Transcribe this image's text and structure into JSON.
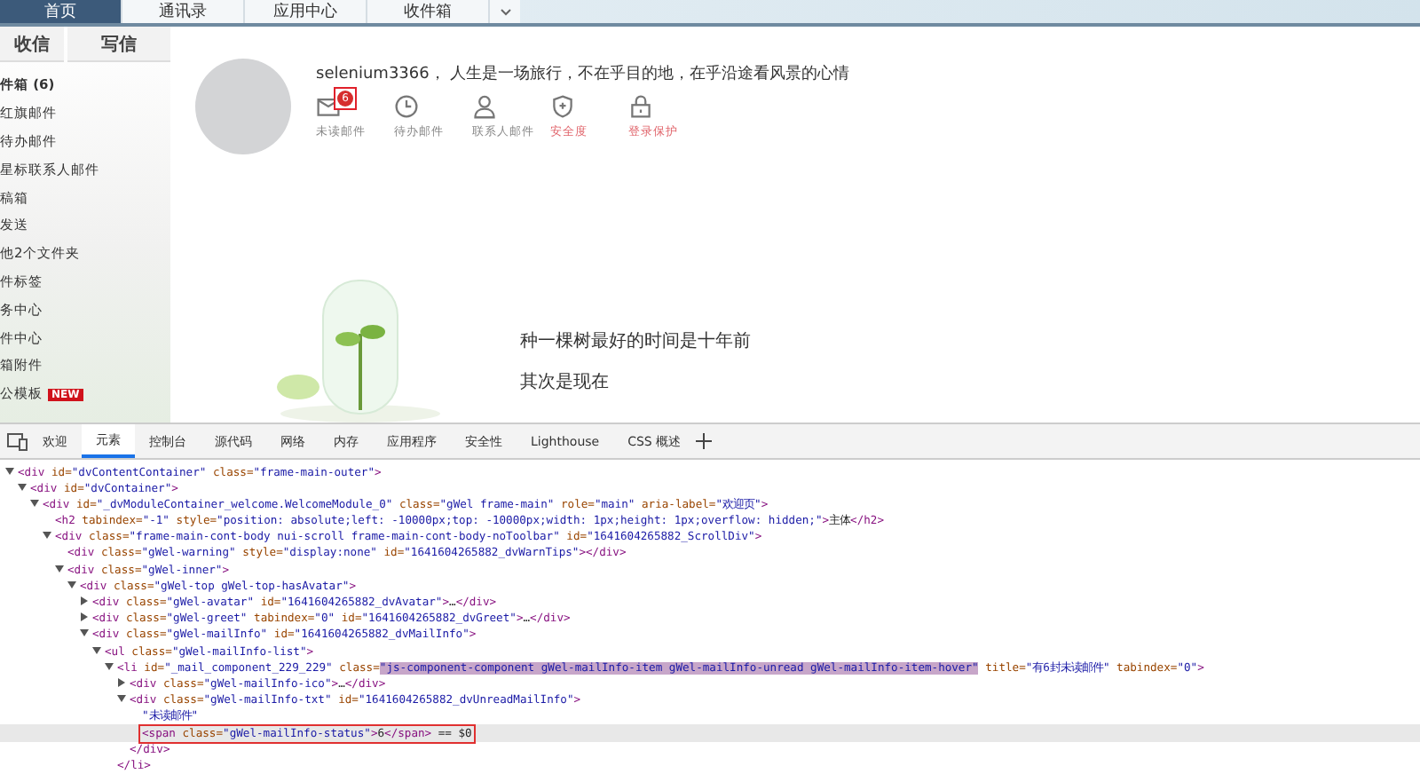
{
  "nav_tabs": [
    {
      "label": "首页",
      "selected": true
    },
    {
      "label": "通讯录",
      "selected": false
    },
    {
      "label": "应用中心",
      "selected": false
    },
    {
      "label": "收件箱",
      "selected": false
    }
  ],
  "sidebar": {
    "buttons": [
      "收信",
      "写信"
    ],
    "items": [
      {
        "label": "件箱 (6)",
        "bold": true
      },
      {
        "label": "红旗邮件",
        "bold": false
      },
      {
        "label": "待办邮件",
        "bold": false
      },
      {
        "label": "星标联系人邮件",
        "bold": false
      },
      {
        "label": "稿箱",
        "bold": false
      },
      {
        "label": "发送",
        "bold": false
      },
      {
        "label": "他2个文件夹",
        "bold": false
      },
      {
        "label": "件标签",
        "bold": false
      },
      {
        "label": "务中心",
        "bold": false
      },
      {
        "label": "件中心",
        "bold": false
      },
      {
        "label": "箱附件",
        "bold": false
      },
      {
        "label": "公模板",
        "bold": false,
        "badge": "NEW"
      }
    ]
  },
  "greeting": "selenium3366， 人生是一场旅行，不在乎目的地，在乎沿途看风景的心情",
  "mail_info": [
    {
      "kind": "mail",
      "label": "未读邮件",
      "badge": "6",
      "alert": false
    },
    {
      "kind": "clock",
      "label": "待办邮件",
      "alert": false
    },
    {
      "kind": "contact",
      "label": "联系人邮件",
      "alert": false
    },
    {
      "kind": "shield",
      "label": "安全度",
      "alert": true
    },
    {
      "kind": "lock",
      "label": "登录保护",
      "alert": true
    }
  ],
  "quote": [
    "种一棵树最好的时间是十年前",
    "其次是现在"
  ],
  "devtools": {
    "tabs": [
      {
        "label": "欢迎",
        "selected": false
      },
      {
        "label": "元素",
        "selected": true
      },
      {
        "label": "控制台",
        "selected": false
      },
      {
        "label": "源代码",
        "selected": false
      },
      {
        "label": "网络",
        "selected": false
      },
      {
        "label": "内存",
        "selected": false
      },
      {
        "label": "应用程序",
        "selected": false
      },
      {
        "label": "安全性",
        "selected": false
      },
      {
        "label": "Lighthouse",
        "selected": false
      },
      {
        "label": "CSS 概述",
        "selected": false
      }
    ],
    "tree": [
      {
        "text": "<div id=\"dvContentContainer\" class=\"frame-main-outer\">",
        "expanded": true,
        "children": [
          {
            "text": "<div id=\"dvContainer\">",
            "expanded": true,
            "children": [
              {
                "text": "<div id=\"_dvModuleContainer_welcome.WelcomeModule_0\" class=\"gWel frame-main\" role=\"main\" aria-label=\"欢迎页\">",
                "expanded": true,
                "children": [
                  {
                    "text": "<h2 tabindex=\"-1\" style=\"position: absolute;left: -10000px;top: -10000px;width: 1px;height: 1px;overflow: hidden;\">主体</h2>"
                  },
                  {
                    "text": "<div class=\"frame-main-cont-body nui-scroll frame-main-cont-body-noToolbar\" id=\"1641604265882_ScrollDiv\">",
                    "expanded": true,
                    "children": [
                      {
                        "text": "<div class=\"gWel-warning\" style=\"display:none\" id=\"1641604265882_dvWarnTips\"></div>"
                      },
                      {
                        "text": "<div class=\"gWel-inner\">",
                        "expanded": true,
                        "children": [
                          {
                            "text": "<div class=\"gWel-top gWel-top-hasAvatar\">",
                            "expanded": true,
                            "children": [
                              {
                                "text": "<div class=\"gWel-avatar\" id=\"1641604265882_dvAvatar\">…</div>",
                                "expanded": false
                              },
                              {
                                "text": "<div class=\"gWel-greet\" tabindex=\"0\" id=\"1641604265882_dvGreet\">…</div>",
                                "expanded": false
                              },
                              {
                                "text": "<div class=\"gWel-mailInfo\" id=\"1641604265882_dvMailInfo\">",
                                "expanded": true,
                                "children": [
                                  {
                                    "text": "<ul class=\"gWel-mailInfo-list\">",
                                    "expanded": true,
                                    "children": [
                                      {
                                        "text": "<li id=\"_mail_component_229_229\" class=\"js-component-component gWel-mailInfo-item gWel-mailInfo-unread gWel-mailInfo-item-hover\" title=\"有6封未读邮件\" tabindex=\"0\">",
                                        "expanded": true,
                                        "highlighted": true,
                                        "close": "</li>",
                                        "children": [
                                          {
                                            "text": "<div class=\"gWel-mailInfo-ico\">…</div>",
                                            "expanded": false
                                          },
                                          {
                                            "text": "<div class=\"gWel-mailInfo-txt\" id=\"1641604265882_dvUnreadMailInfo\">",
                                            "expanded": true,
                                            "close": "</div>",
                                            "children": [
                                              {
                                                "text": "\"未读邮件\""
                                              },
                                              {
                                                "text": "<span class=\"gWel-mailInfo-status\">6</span> == $0",
                                                "selected": true
                                              }
                                            ]
                                          }
                                        ]
                                      }
                                    ]
                                  }
                                ]
                              }
                            ]
                          }
                        ]
                      }
                    ]
                  }
                ]
              }
            ]
          }
        ]
      }
    ]
  }
}
